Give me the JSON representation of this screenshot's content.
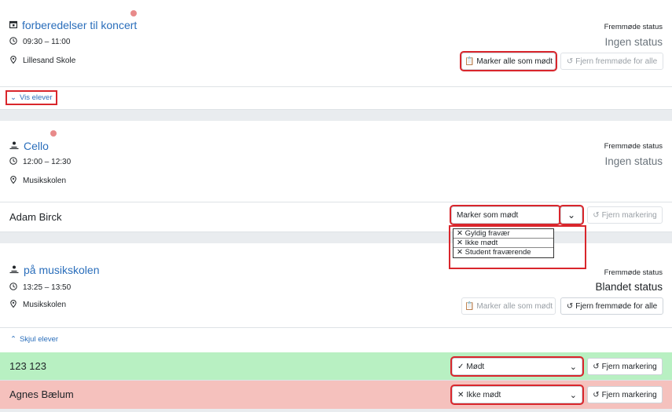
{
  "events": [
    {
      "title": "forberedelser til koncert",
      "time": "09:30 – 11:00",
      "location": "Lillesand Skole",
      "status_label": "Fremmøde status",
      "status_value": "Ingen status",
      "mark_all": "Marker alle som mødt",
      "remove_all": "Fjern fremmøde for alle",
      "toggle": "Vis elever"
    },
    {
      "title": "Cello",
      "time": "12:00 – 12:30",
      "location": "Musikskolen",
      "status_label": "Fremmøde status",
      "status_value": "Ingen status",
      "student": {
        "name": "Adam Birck",
        "select_value": "Marker som mødt",
        "remove": "Fjern markering",
        "options": [
          "Gyldig fravær",
          "Ikke mødt",
          "Student fraværende"
        ]
      }
    },
    {
      "title": "på musikskolen",
      "time": "13:25 – 13:50",
      "location": "Musikskolen",
      "status_label": "Fremmøde status",
      "status_value": "Blandet status",
      "mark_all": "Marker alle som mødt",
      "remove_all": "Fjern fremmøde for alle",
      "toggle": "Skjul elever",
      "students": [
        {
          "name": "123 123",
          "select_value": "Mødt",
          "remove": "Fjern markering",
          "color": "#b8f0c2"
        },
        {
          "name": "Agnes Bælum",
          "select_value": "Ikke mødt",
          "remove": "Fjern markering",
          "color": "#f5c1bd"
        }
      ]
    }
  ],
  "icons": {
    "calendar": "calendar-icon",
    "person": "person-icon",
    "clock": "clock-icon",
    "location": "location-pin-icon",
    "clipboard": "clipboard-icon",
    "undo": "undo-icon",
    "chevron": "chevron-icon",
    "check": "check-icon",
    "x": "x-icon"
  }
}
